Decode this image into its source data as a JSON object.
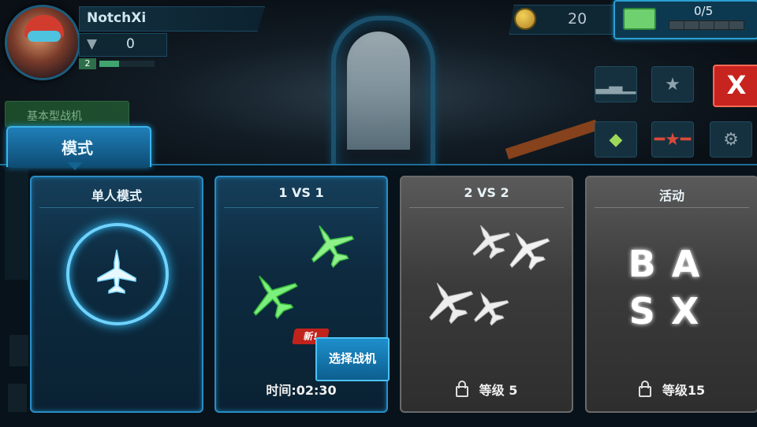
{
  "player": {
    "name": "NotchXi",
    "rank_value": "0",
    "level": "2",
    "level_progress": 0.35
  },
  "currency": {
    "coins": "20",
    "cash_count": "0/5"
  },
  "side": {
    "basic_fighter_tab": "基本型战机"
  },
  "mode_tab": {
    "label": "模式"
  },
  "cards": {
    "single": {
      "title": "单人模式"
    },
    "one_vs_one": {
      "title": "1 VS 1",
      "new_badge": "新!",
      "select_button": "选择战机",
      "time": "时间:02:30"
    },
    "two_vs_two": {
      "title": "2 VS 2",
      "requirement": "等级 5"
    },
    "event": {
      "title": "活动",
      "logo_line1": "BA",
      "logo_line2": "SX",
      "requirement": "等级15"
    }
  },
  "colors": {
    "accent": "#2aa0d2",
    "close": "#c8241f",
    "jet_green": "#7cf07c",
    "locked_grey": "#3b3b3b"
  },
  "close_label": "X"
}
